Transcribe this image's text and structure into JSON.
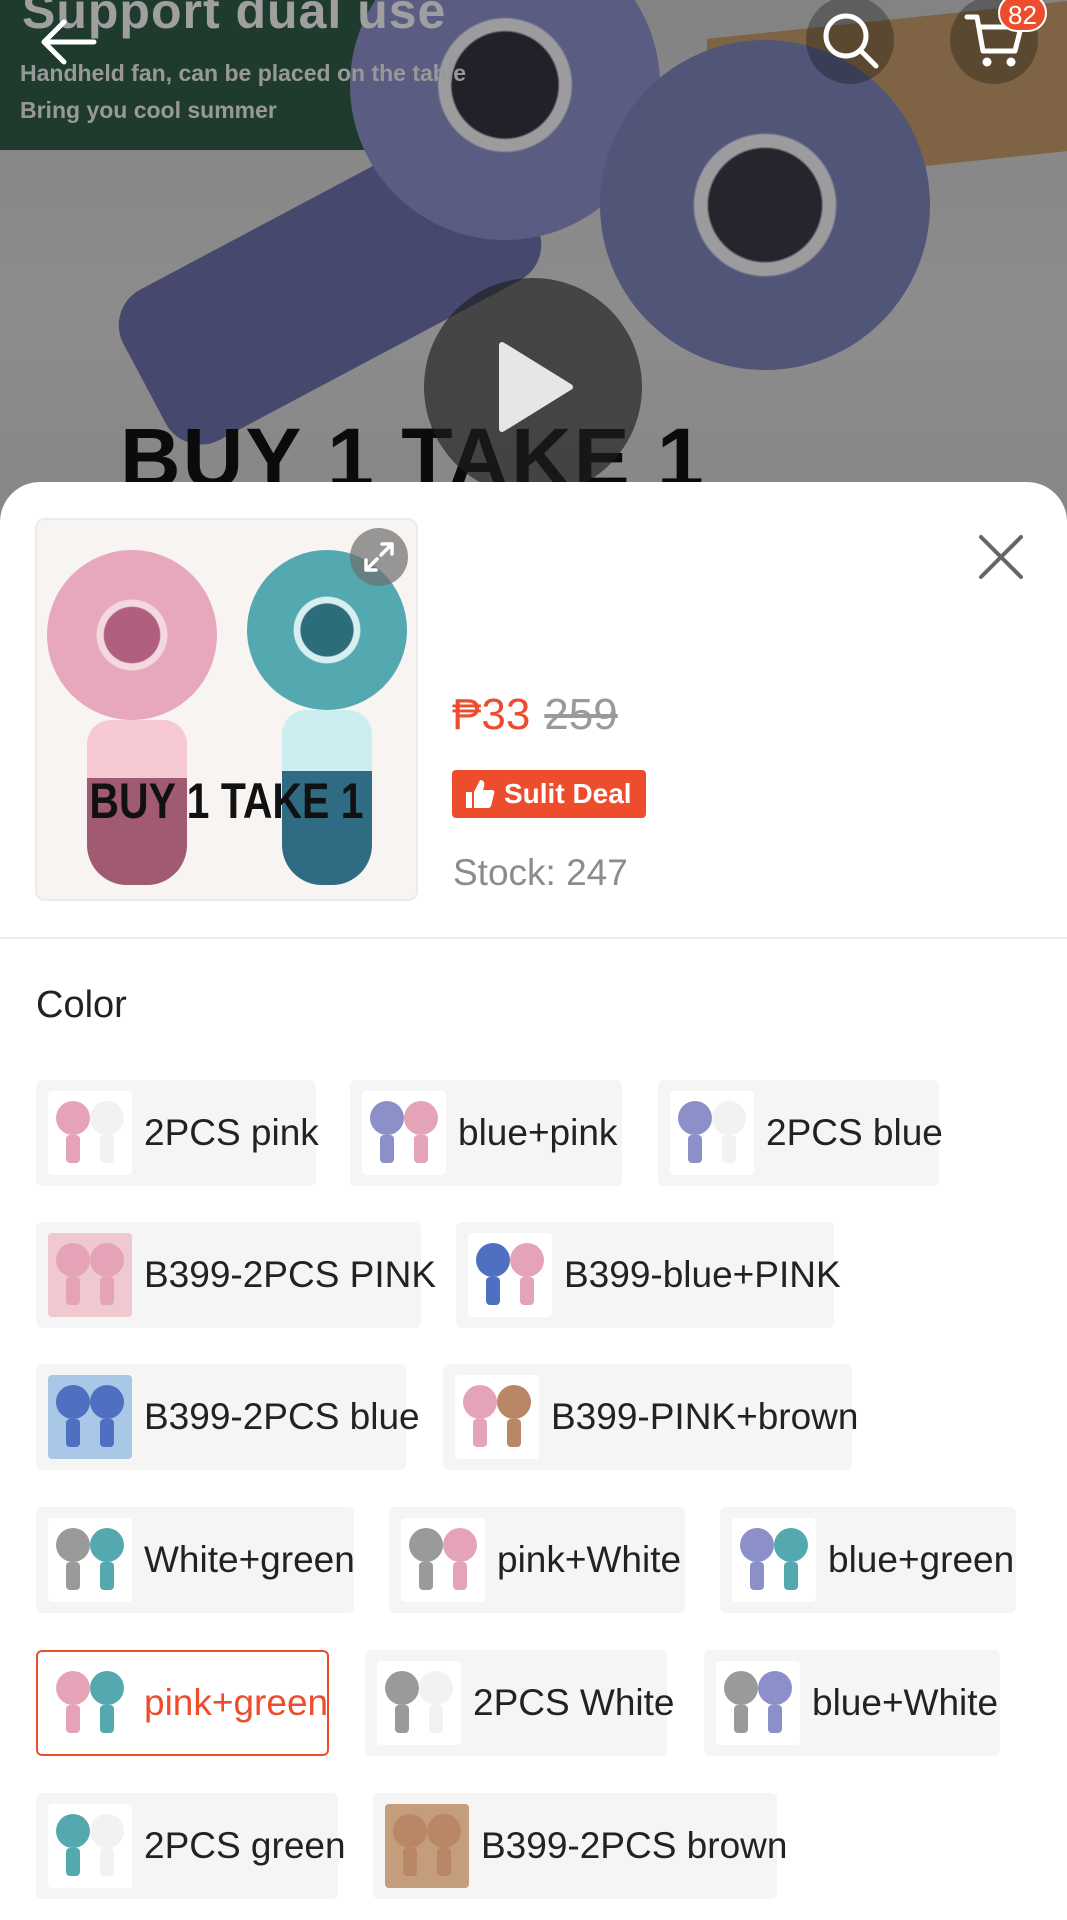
{
  "hero": {
    "title": "Support dual use",
    "subtitle_line1": "Handheld fan, can be placed on the table",
    "subtitle_line2": "Bring you cool summer",
    "promo_text": "BUY 1 TAKE 1",
    "cart_count": "82"
  },
  "product": {
    "thumb_text": "BUY 1 TAKE 1",
    "price": "₱33",
    "original_price": "259",
    "deal_label": "Sulit Deal",
    "stock_text": "Stock: 247"
  },
  "variations": {
    "title": "Color",
    "selected": "pink+green",
    "options": [
      {
        "label": "2PCS pink",
        "colors": [
          "#e5a3b8",
          "#f2f2f2"
        ]
      },
      {
        "label": "blue+pink",
        "colors": [
          "#8c90c8",
          "#e5a3b8"
        ]
      },
      {
        "label": "2PCS blue",
        "colors": [
          "#8c90c8",
          "#f2f2f2"
        ]
      },
      {
        "label": "B399-2PCS PINK",
        "colors": [
          "#e5a3b8",
          "#e5a3b8"
        ]
      },
      {
        "label": "B399-blue+PINK",
        "colors": [
          "#4f6fc1",
          "#e5a3b8"
        ]
      },
      {
        "label": "B399-2PCS blue",
        "colors": [
          "#4f6fc1",
          "#4f6fc1"
        ]
      },
      {
        "label": "B399-PINK+brown",
        "colors": [
          "#e5a3b8",
          "#b98766"
        ]
      },
      {
        "label": "White+green",
        "colors": [
          "#9a9a9a",
          "#54a8b0"
        ]
      },
      {
        "label": "pink+White",
        "colors": [
          "#9a9a9a",
          "#e5a3b8"
        ]
      },
      {
        "label": "blue+green",
        "colors": [
          "#8c90c8",
          "#54a8b0"
        ]
      },
      {
        "label": "pink+green",
        "colors": [
          "#e5a3b8",
          "#54a8b0"
        ]
      },
      {
        "label": "2PCS White",
        "colors": [
          "#9a9a9a",
          "#f2f2f2"
        ]
      },
      {
        "label": "blue+White",
        "colors": [
          "#9a9a9a",
          "#8c90c8"
        ]
      },
      {
        "label": "2PCS green",
        "colors": [
          "#54a8b0",
          "#f2f2f2"
        ]
      },
      {
        "label": "B399-2PCS brown",
        "colors": [
          "#b98766",
          "#b98766"
        ]
      }
    ]
  },
  "colors": {
    "accent": "#ee4d2d",
    "muted_text": "#8c8c8c"
  },
  "icons": {
    "back": "arrow-left-icon",
    "search": "search-icon",
    "cart": "cart-icon",
    "play": "play-icon",
    "expand": "expand-icon",
    "close": "close-icon",
    "deal": "thumbs-up-icon"
  }
}
